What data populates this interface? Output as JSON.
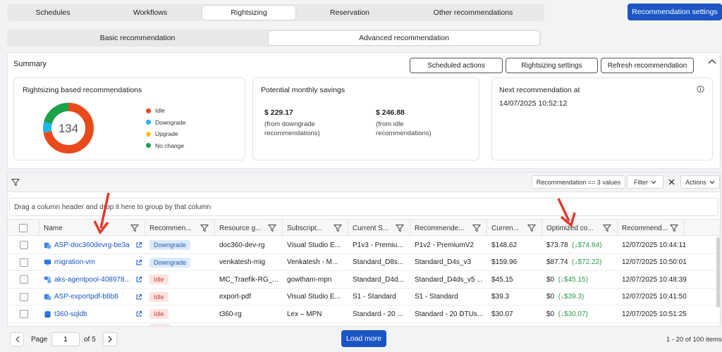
{
  "top_tabs": [
    {
      "label": "Schedules"
    },
    {
      "label": "Workflows"
    },
    {
      "label": "Rightsizing",
      "active": true
    },
    {
      "label": "Reservation"
    },
    {
      "label": "Other recommendations"
    }
  ],
  "recommendation_settings_label": "Recommendation settings",
  "sub_tabs": [
    {
      "label": "Basic recommendation"
    },
    {
      "label": "Advanced recommendation",
      "active": true
    }
  ],
  "summary": {
    "title": "Summary",
    "buttons": {
      "scheduled": "Scheduled actions",
      "rightsizing": "Rightsizing settings",
      "refresh": "Refresh recommendation"
    },
    "donut_card": {
      "title": "Rightsizing based recommendations",
      "total": "134",
      "segments": [
        {
          "label": "Idle",
          "color": "#e84a1b",
          "fraction": 0.72
        },
        {
          "label": "Downgrade",
          "color": "#1fb6e8",
          "fraction": 0.07
        },
        {
          "label": "Upgrade",
          "color": "#f5c518",
          "fraction": 0.0
        },
        {
          "label": "No change",
          "color": "#1aa14a",
          "fraction": 0.21
        }
      ]
    },
    "savings_card": {
      "title": "Potential monthly savings",
      "items": [
        {
          "amount": "$ 229.17",
          "note1": "(from downgrade",
          "note2": "recommendations)"
        },
        {
          "amount": "$ 246.88",
          "note1": "(from idle",
          "note2": "recommendations)"
        }
      ]
    },
    "next_card": {
      "title": "Next recommendation at",
      "value": "14/07/2025 10:52:12"
    }
  },
  "grid": {
    "filter_chip": "Recommendation == 3 values",
    "filter_btn": "Filter",
    "actions_btn": "Actions",
    "group_hint": "Drag a column header and drop it here to group by that column",
    "columns": [
      "Name",
      "Recommen...",
      "Resource g...",
      "Subscript...",
      "Current S...",
      "Recommende...",
      "Curren...",
      "Optimized co...",
      "Recommend..."
    ],
    "rows": [
      {
        "name": "ASP-doc360devrg-be3a",
        "type": "asp",
        "rec": "Downgrade",
        "rg": "doc360-dev-rg",
        "sub": "Visual Studio E...",
        "cur": "P1v3 - Premiu...",
        "recsku": "P1v2 - PremiumV2",
        "cost": "$148.62",
        "opt": "$73.78",
        "save": "(↓$74.84)",
        "date": "12/07/2025 10:44:11"
      },
      {
        "name": "migration-vm",
        "type": "vm",
        "rec": "Downgrade",
        "rg": "venkatesh-mig",
        "sub": "Venkatesh - M...",
        "cur": "Standard_D8s...",
        "recsku": "Standard_D4s_v3",
        "cost": "$159.96",
        "opt": "$87.74",
        "save": "(↓$72.22)",
        "date": "12/07/2025 10:50:01"
      },
      {
        "name": "aks-agentpool-408978...",
        "type": "aks",
        "rec": "Idle",
        "rg": "MC_Traefik-RG_...",
        "sub": "gowtham-mpn",
        "cur": "Standard_D4d...",
        "recsku": "Standard_D4ds_v5 ...",
        "cost": "$45.15",
        "opt": "$0",
        "save": "(↓$45.15)",
        "date": "12/07/2025 10:48:39"
      },
      {
        "name": "ASP-exportpdf-b8b8",
        "type": "asp",
        "rec": "Idle",
        "rg": "export-pdf",
        "sub": "Visual Studio E...",
        "cur": "S1 - Standard",
        "recsku": "S1 - Standard",
        "cost": "$39.3",
        "opt": "$0",
        "save": "(↓$39.3)",
        "date": "12/07/2025 10:41:50"
      },
      {
        "name": "t360-sqldb",
        "type": "sql",
        "rec": "Idle",
        "rg": "t360-rg",
        "sub": "Lex – MPN",
        "cur": "Standard - 20 ...",
        "recsku": "Standard - 20 DTUs...",
        "cost": "$30.07",
        "opt": "$0",
        "save": "(↓$30.07)",
        "date": "12/07/2025 10:51:25"
      }
    ]
  },
  "footer": {
    "page_label": "Page",
    "page_value": "1",
    "of_label": "of 5",
    "load_more": "Load more",
    "items_info": "1 - 20 of 100 items"
  }
}
